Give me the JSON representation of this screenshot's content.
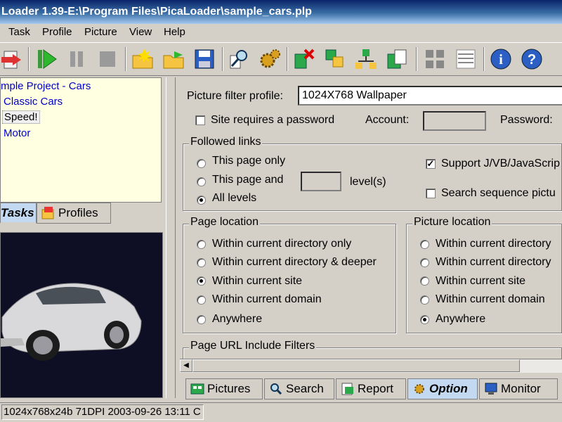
{
  "window": {
    "title": "Loader 1.39-E:\\Program Files\\PicaLoader\\sample_cars.plp"
  },
  "menu": {
    "items": [
      "Task",
      "Profile",
      "Picture",
      "View",
      "Help"
    ]
  },
  "toolbar": {
    "buttons": [
      "exit-icon",
      "start-icon",
      "pause-icon",
      "stop-icon",
      "new-folder-icon",
      "open-folder-icon",
      "save-icon",
      "find-icon",
      "settings-gear-icon",
      "delete-icon",
      "copy-icon",
      "network-icon",
      "properties-icon",
      "thumbnails-view-icon",
      "details-view-icon",
      "info-icon",
      "help-icon"
    ]
  },
  "tree": {
    "root": "mple Project - Cars",
    "items": [
      "Classic Cars",
      "Speed!",
      "Motor"
    ],
    "selected": "Speed!"
  },
  "left_tabs": {
    "tasks": "Tasks",
    "profiles": "Profiles"
  },
  "options": {
    "filter_profile_label": "Picture filter profile:",
    "filter_profile_value": "1024X768 Wallpaper",
    "site_password_label": "Site requires a password",
    "site_password_checked": false,
    "account_label": "Account:",
    "account_value": "",
    "password_label": "Password:",
    "followed_links": {
      "title": "Followed links",
      "options": [
        "This page only",
        "This page and",
        "All levels"
      ],
      "selected": "All levels",
      "levels_value": "",
      "levels_label": "level(s)"
    },
    "support_js_label": "Support J/VB/JavaScrip",
    "support_js_checked": true,
    "search_sequence_label": "Search sequence pictu",
    "search_sequence_checked": false,
    "page_location": {
      "title": "Page location",
      "options": [
        "Within current directory only",
        "Within current directory & deeper",
        "Within current site",
        "Within current domain",
        "Anywhere"
      ],
      "selected": "Within current site"
    },
    "picture_location": {
      "title": "Picture location",
      "options": [
        "Within current directory",
        "Within current directory",
        "Within current site",
        "Within current domain",
        "Anywhere"
      ],
      "selected": "Anywhere"
    },
    "url_include_label": "Page URL Include Filters"
  },
  "bottom_tabs": [
    "Pictures",
    "Search",
    "Report",
    "Option",
    "Monitor"
  ],
  "active_bottom_tab": "Option",
  "status": {
    "info": "1024x768x24b 71DPI 2003-09-26 13:11 C"
  },
  "colors": {
    "title_blue": "#0a246a",
    "tree_bg": "#ffffe1",
    "tab_active": "#c3d9f2",
    "link_blue": "#0000cc"
  }
}
